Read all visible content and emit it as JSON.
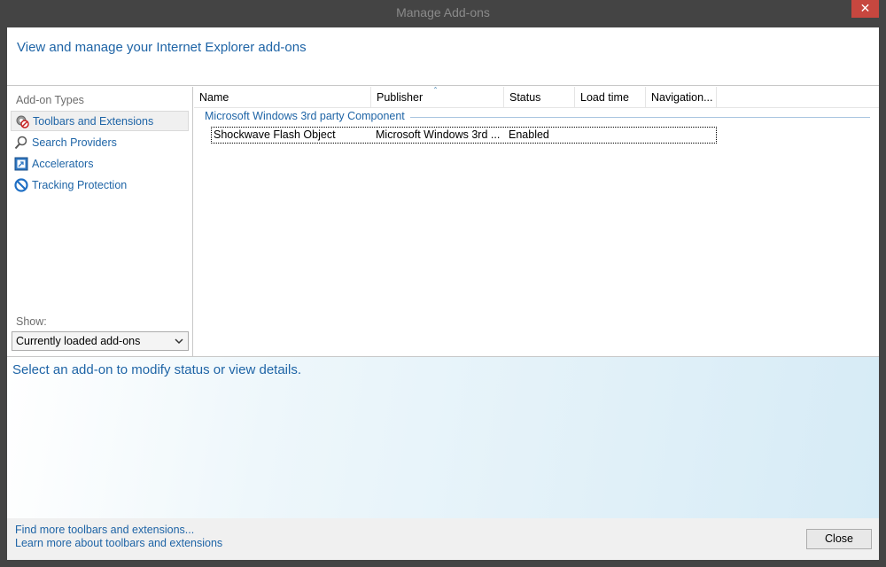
{
  "window": {
    "title": "Manage Add-ons",
    "close_glyph": "✕"
  },
  "header": {
    "title": "View and manage your Internet Explorer add-ons"
  },
  "sidebar": {
    "types_label": "Add-on Types",
    "items": [
      {
        "label": "Toolbars and Extensions",
        "icon": "toolbars-extensions-icon",
        "selected": true
      },
      {
        "label": "Search Providers",
        "icon": "search-icon",
        "selected": false
      },
      {
        "label": "Accelerators",
        "icon": "accelerator-icon",
        "selected": false
      },
      {
        "label": "Tracking Protection",
        "icon": "tracking-protection-icon",
        "selected": false
      }
    ],
    "show_label": "Show:",
    "show_value": "Currently loaded add-ons"
  },
  "list": {
    "columns": [
      "Name",
      "Publisher",
      "Status",
      "Load time",
      "Navigation..."
    ],
    "sorted_column": "Publisher",
    "sort_glyph": "ˆ",
    "group": "Microsoft Windows 3rd party Component",
    "rows": [
      {
        "name": "Shockwave Flash Object",
        "publisher": "Microsoft Windows 3rd ...",
        "status": "Enabled",
        "load_time": "",
        "navigation": ""
      }
    ]
  },
  "details": {
    "prompt": "Select an add-on to modify status or view details."
  },
  "footer": {
    "link1": "Find more toolbars and extensions...",
    "link2": "Learn more about toolbars and extensions",
    "close_label": "Close"
  },
  "colors": {
    "accent_blue": "#1e64a6",
    "titlebar": "#444444",
    "close_red": "#c7473f"
  }
}
